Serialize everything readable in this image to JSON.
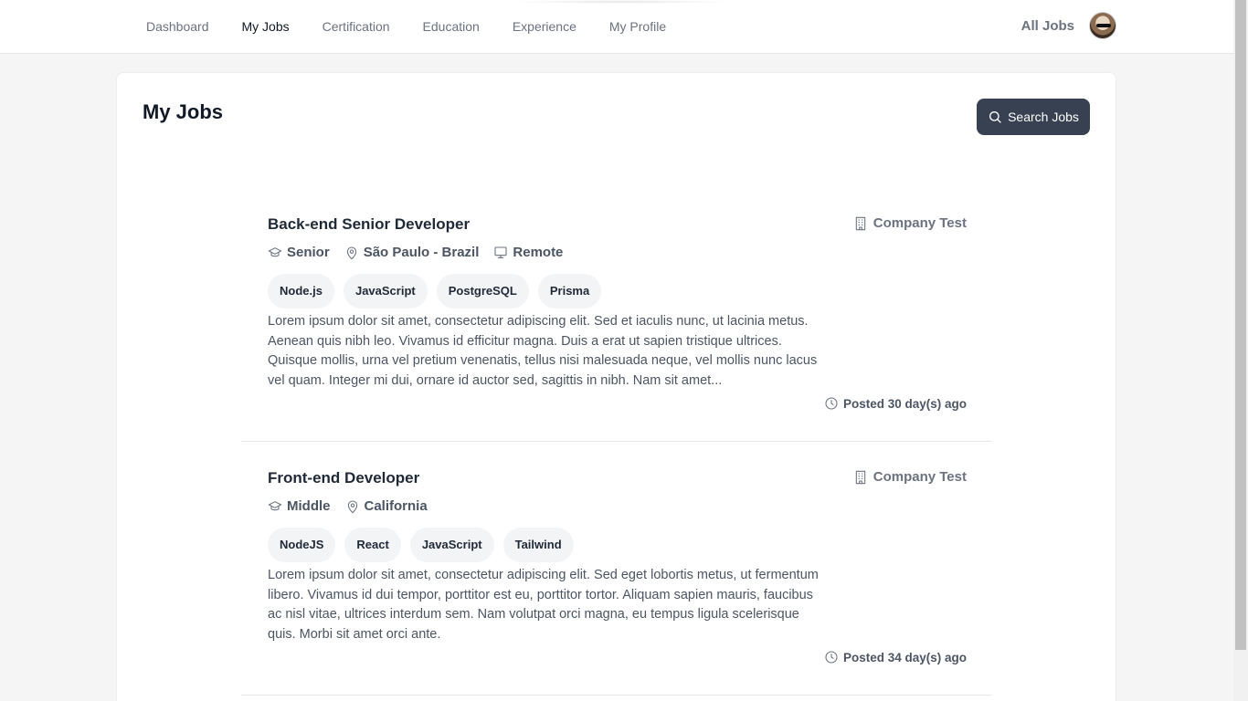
{
  "nav": {
    "items": [
      {
        "label": "Dashboard",
        "active": false
      },
      {
        "label": "My Jobs",
        "active": true
      },
      {
        "label": "Certification",
        "active": false
      },
      {
        "label": "Education",
        "active": false
      },
      {
        "label": "Experience",
        "active": false
      },
      {
        "label": "My Profile",
        "active": false
      }
    ],
    "all_jobs_label": "All Jobs",
    "avatar_icon": "user-avatar"
  },
  "page": {
    "title": "My Jobs",
    "search_button_label": "Search Jobs",
    "search_icon": "search-icon"
  },
  "jobs": [
    {
      "title": "Back-end Senior Developer",
      "company": "Company Test",
      "level": "Senior",
      "location": "São Paulo - Brazil",
      "work_mode": "Remote",
      "tags": [
        "Node.js",
        "JavaScript",
        "PostgreSQL",
        "Prisma"
      ],
      "description": "Lorem ipsum dolor sit amet, consectetur adipiscing elit. Sed et iaculis nunc, ut lacinia metus. Aenean quis nibh leo. Vivamus id efficitur magna. Duis a erat ut sapien tristique ultrices. Quisque mollis, urna vel pretium venenatis, tellus nisi malesuada neque, vel mollis nunc lacus vel quam. Integer mi dui, ornare id auctor sed, sagittis in nibh. Nam sit amet...",
      "posted": "Posted 30 day(s) ago"
    },
    {
      "title": "Front-end Developer",
      "company": "Company Test",
      "level": "Middle",
      "location": "California",
      "tags": [
        "NodeJS",
        "React",
        "JavaScript",
        "Tailwind"
      ],
      "description": "Lorem ipsum dolor sit amet, consectetur adipiscing elit. Sed eget lobortis metus, ut fermentum libero. Vivamus id dui tempor, porttitor est eu, porttitor tortor. Aliquam sapien mauris, faucibus ac nisl vitae, ultrices interdum sem. Nam volutpat orci magna, eu tempus ligula scelerisque quis. Morbi sit amet orci ante.",
      "posted": "Posted 34 day(s) ago"
    }
  ]
}
